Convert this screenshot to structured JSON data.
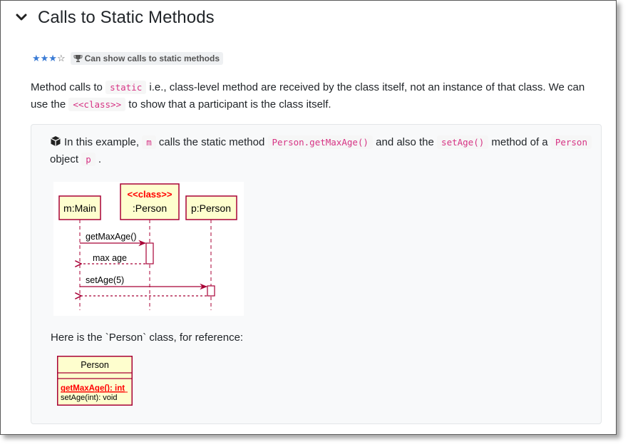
{
  "section": {
    "title": "Calls to Static Methods"
  },
  "meta": {
    "stars": "★★★",
    "stars_empty": "☆",
    "badge_icon": "trophy-icon",
    "badge_text": "Can show calls to static methods"
  },
  "intro": {
    "t1": "Method calls to ",
    "code1": "static",
    "t2": " i.e., class-level method are received by the class itself, not an instance of that class. We can use the ",
    "code2": "<<class>>",
    "t3": " to show that a participant is the class itself."
  },
  "example": {
    "icon": "box-icon",
    "t1": "In this example, ",
    "code_m": "m",
    "t2": " calls the static method ",
    "code_method": "Person.getMaxAge()",
    "t3": " and also the ",
    "code_set": "setAge()",
    "t4": " method of a ",
    "code_person": "Person",
    "t5": " object ",
    "code_p": "p",
    "t6": " .",
    "reference_text": "Here is the `Person` class, for reference:"
  },
  "sequence_diagram": {
    "participants": {
      "main": "m:Main",
      "stereotype": "<<class>>",
      "person_class": ":Person",
      "person_obj": "p:Person"
    },
    "messages": {
      "m1": "getMaxAge()",
      "m2": "max age",
      "m3": "setAge(5)"
    },
    "colors": {
      "border": "#a80036",
      "fill": "#fefece",
      "stereotype": "#ff0000"
    }
  },
  "class_diagram": {
    "name": "Person",
    "static_method": "getMaxAge(): int",
    "method": "setAge(int): void"
  }
}
